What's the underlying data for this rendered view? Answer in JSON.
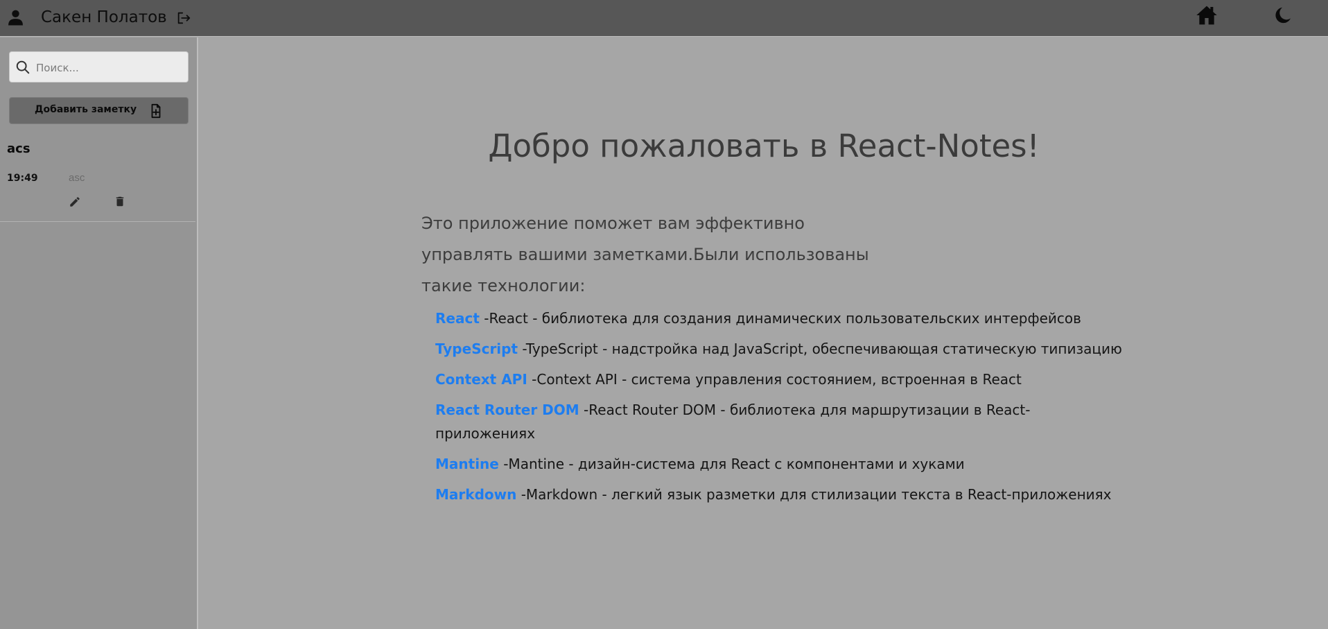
{
  "header": {
    "user_name": "Сакен Полатов"
  },
  "sidebar": {
    "search": {
      "placeholder": "Поиск..."
    },
    "add_button_label": "Добавить заметку",
    "notes": [
      {
        "title": "acs",
        "time": "19:49",
        "preview": "asc"
      }
    ]
  },
  "main": {
    "title": "Добро пожаловать в React-Notes!",
    "intro": "Это приложение поможет вам эффективно управлять вашими заметками.Были использованы такие технологии:",
    "technologies": [
      {
        "name": "React",
        "description": "-React - библиотека для создания динамических пользовательских интерфейсов"
      },
      {
        "name": "TypeScript",
        "description": "-TypeScript - надстройка над JavaScript, обеспечивающая статическую типизацию"
      },
      {
        "name": "Context API",
        "description": "-Context API - система управления состоянием, встроенная в React"
      },
      {
        "name": "React Router DOM",
        "description": "-React Router DOM - библиотека для маршрутизации в React-приложениях"
      },
      {
        "name": "Mantine",
        "description": "-Mantine - дизайн-система для React с компонентами и хуками"
      },
      {
        "name": "Markdown",
        "description": "-Markdown - легкий язык разметки для стилизации текста в React-приложениях"
      }
    ]
  },
  "colors": {
    "header_bg": "#575757",
    "sidebar_bg": "#959595",
    "main_bg": "#a6a6a6",
    "link": "#1d7df0"
  }
}
